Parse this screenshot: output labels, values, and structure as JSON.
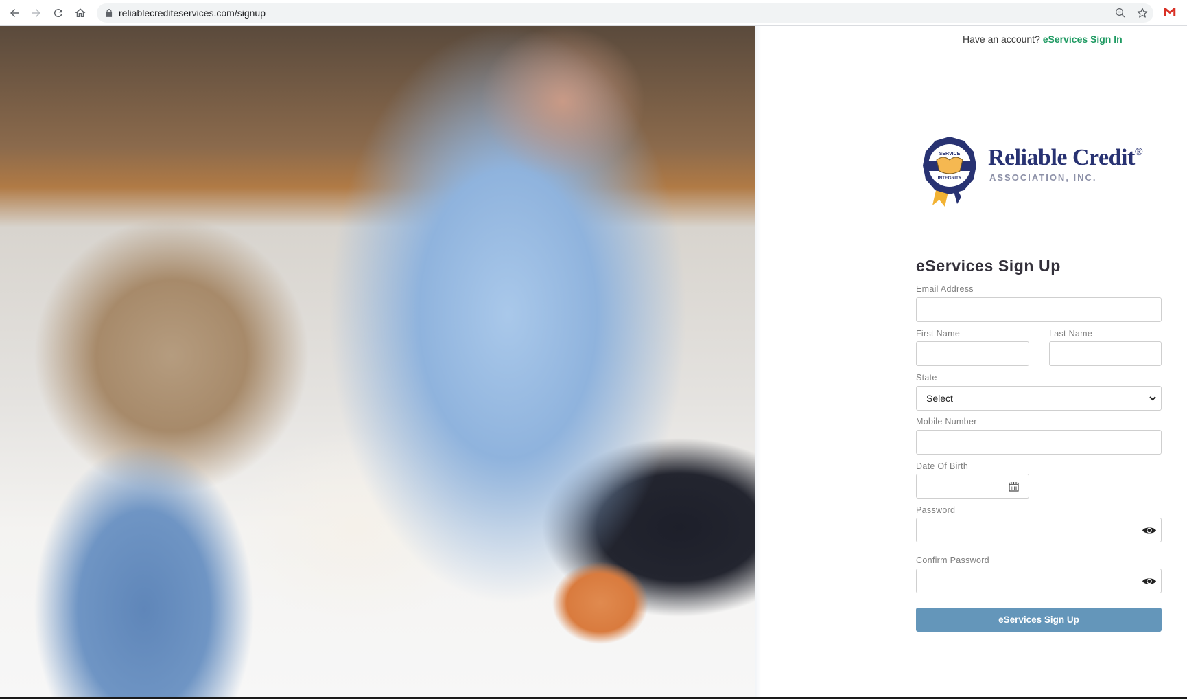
{
  "browser": {
    "url": "reliablecrediteservices.com/signup",
    "icons": [
      "back-arrow-icon",
      "forward-arrow-icon",
      "reload-icon",
      "home-icon",
      "lock-icon",
      "zoom-out-icon",
      "bookmark-star-icon",
      "gmail-icon"
    ]
  },
  "header": {
    "prompt": "Have an account?",
    "signin_link": "eServices Sign In",
    "link_color": "#1f9a62"
  },
  "logo": {
    "badge_top": "SERVICE",
    "badge_bottom": "INTEGRITY",
    "name": "Reliable Credit",
    "registered": "®",
    "subtitle": "ASSOCIATION, INC.",
    "brand_color": "#283272",
    "accent_color": "#f2b233"
  },
  "form": {
    "title": "eServices Sign Up",
    "email_label": "Email Address",
    "email_value": "",
    "first_name_label": "First Name",
    "first_name_value": "",
    "last_name_label": "Last Name",
    "last_name_value": "",
    "state_label": "State",
    "state_selected": "Select",
    "mobile_label": "Mobile Number",
    "mobile_value": "",
    "dob_label": "Date Of Birth",
    "dob_value": "",
    "password_label": "Password",
    "password_value": "",
    "confirm_password_label": "Confirm Password",
    "confirm_password_value": "",
    "submit_label": "eServices Sign Up",
    "submit_color": "#6496ba"
  }
}
